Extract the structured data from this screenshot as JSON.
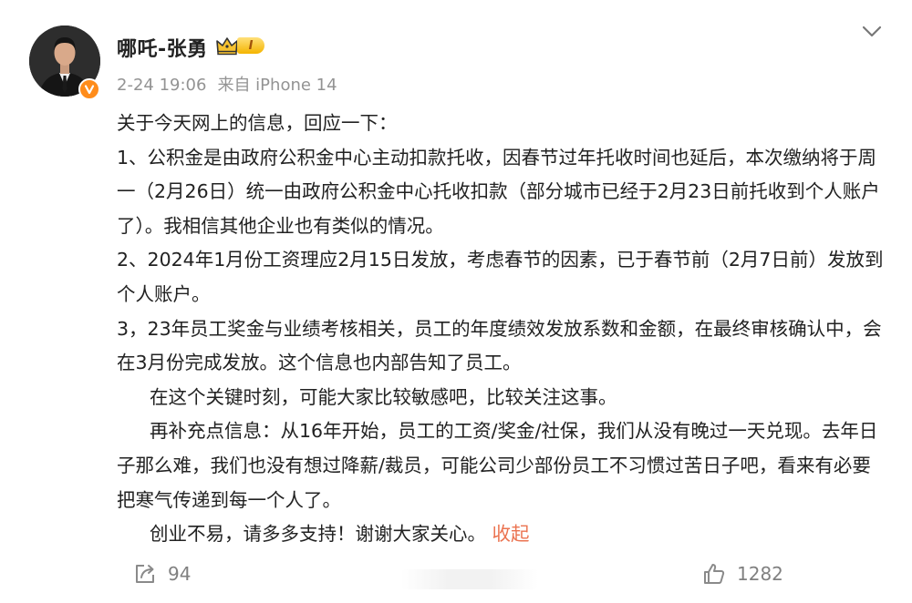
{
  "post": {
    "author": "哪吒-张勇",
    "level_badge": "I",
    "time": "2-24 19:06",
    "source": "来自 iPhone 14",
    "paragraphs": [
      "关于今天网上的信息，回应一下：",
      "1、公积金是由政府公积金中心主动扣款托收，因春节过年托收时间也延后，本次缴纳将于周一（2月26日）统一由政府公积金中心托收扣款（部分城市已经于2月23日前托收到个人账户了）。我相信其他企业也有类似的情况。",
      "2、2024年1月份工资理应2月15日发放，考虑春节的因素，已于春节前（2月7日前）发放到个人账户。",
      "3，23年员工奖金与业绩考核相关，员工的年度绩效发放系数和金额，在最终审核确认中，会在3月份完成发放。这个信息也内部告知了员工。",
      "在这个关键时刻，可能大家比较敏感吧，比较关注这事。",
      "再补充点信息：从16年开始，员工的工资/奖金/社保，我们从没有晚过一天兑现。去年日子那么难，我们也没有想过降薪/裁员，可能公司少部份员工不习惯过苦日子吧，看来有必要把寒气传递到每一个人了。",
      "创业不易，请多多支持！谢谢大家关心。"
    ],
    "collapse_label": "收起",
    "repost_count": "94",
    "like_count": "1282"
  },
  "icons": {
    "verified": "verified-v-icon",
    "crown": "crown-icon",
    "menu": "chevron-down-icon",
    "repost": "repost-icon",
    "like": "thumbs-up-icon"
  },
  "colors": {
    "verified": "#ff8c1a",
    "collapse_link": "#eb7350",
    "meta_text": "#939393",
    "action_text": "#808080"
  }
}
